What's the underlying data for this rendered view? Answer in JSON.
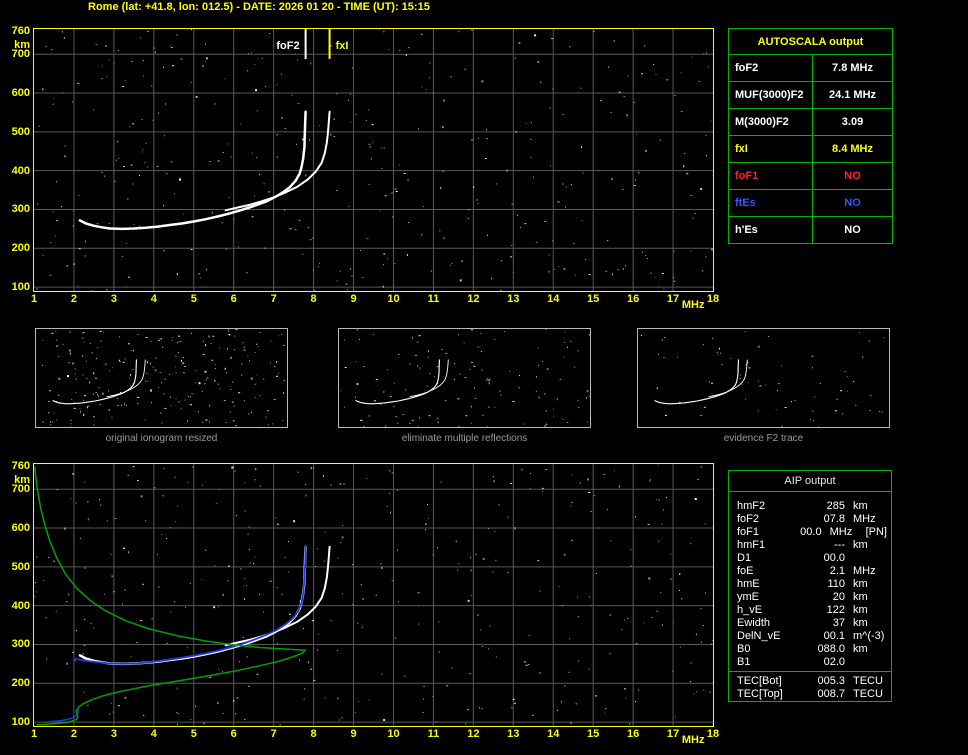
{
  "header": {
    "title": "Rome (lat: +41.8, lon: 012.5) - DATE: 2026 01 20 - TIME (UT): 15:15"
  },
  "colors": {
    "background": "#000000",
    "axis_label": "#ffff00",
    "chart_border": "#ffff00",
    "grid": "#585858",
    "table_border": "#00b400",
    "caption": "#9a9a9a",
    "trace_white": "#ffffff",
    "trace_blue": "#2233ee",
    "profile_green": "#00a000",
    "fxI_yellow": "#ffff00",
    "foF1_red": "#ff2222",
    "ftEs_blue": "#3355ff"
  },
  "autoscala_table": {
    "title": "AUTOSCALA output",
    "rows": [
      {
        "label": "foF2",
        "value": "7.8 MHz",
        "color": "#ffffff"
      },
      {
        "label": "MUF(3000)F2",
        "value": "24.1 MHz",
        "color": "#ffffff"
      },
      {
        "label": "M(3000)F2",
        "value": "3.09",
        "color": "#ffffff"
      },
      {
        "label": "fxI",
        "value": "8.4 MHz",
        "color": "#ffff00"
      },
      {
        "label": "foF1",
        "value": "NO",
        "color": "#ff2222"
      },
      {
        "label": "ftEs",
        "value": "NO",
        "color": "#3355ff"
      },
      {
        "label": "h'Es",
        "value": "NO",
        "color": "#ffffff"
      }
    ]
  },
  "aip_table": {
    "title": "AIP output",
    "rows": [
      {
        "label": "hmF2",
        "value": "285",
        "unit": "km"
      },
      {
        "label": "foF2",
        "value": "07.8",
        "unit": "MHz"
      },
      {
        "label": "foF1",
        "value": "00.0",
        "unit": "MHz",
        "extra": "[PN]"
      },
      {
        "label": "hmF1",
        "value": "---",
        "unit": "km"
      },
      {
        "label": "D1",
        "value": "00.0",
        "unit": ""
      },
      {
        "label": "foE",
        "value": "2.1",
        "unit": "MHz"
      },
      {
        "label": "hmE",
        "value": "110",
        "unit": "km"
      },
      {
        "label": "ymE",
        "value": "20",
        "unit": "km"
      },
      {
        "label": "h_vE",
        "value": "122",
        "unit": "km"
      },
      {
        "label": "Ewidth",
        "value": "37",
        "unit": "km"
      },
      {
        "label": "DelN_vE",
        "value": "00.1",
        "unit": "m^(-3)"
      },
      {
        "label": "B0",
        "value": "088.0",
        "unit": "km"
      },
      {
        "label": "B1",
        "value": "02.0",
        "unit": ""
      }
    ],
    "tec_rows": [
      {
        "label": "TEC[Bot]",
        "value": "005.3",
        "unit": "TECU"
      },
      {
        "label": "TEC[Top]",
        "value": "008.7",
        "unit": "TECU"
      }
    ]
  },
  "thumbnails": [
    {
      "caption": "original ionogram resized"
    },
    {
      "caption": "eliminate multiple reflections"
    },
    {
      "caption": "evidence F2 trace"
    }
  ],
  "chart_data": [
    {
      "id": "top_ionogram",
      "type": "scatter",
      "title": "",
      "xlabel": "MHz",
      "ylabel": "km",
      "xlim": [
        1,
        18
      ],
      "ylim": [
        90,
        765
      ],
      "grid": true,
      "xticks": [
        "1",
        "2",
        "3",
        "4",
        "5",
        "6",
        "7",
        "8",
        "9",
        "10",
        "11",
        "12",
        "13",
        "14",
        "15",
        "16",
        "17",
        "18"
      ],
      "yticks": [
        760,
        700,
        600,
        500,
        400,
        300,
        200,
        100
      ],
      "series": [
        {
          "name": "o-trace",
          "color": "#ffffff",
          "width": 2.5,
          "points": [
            [
              2.15,
              272
            ],
            [
              2.3,
              264
            ],
            [
              2.5,
              258
            ],
            [
              2.7,
              254
            ],
            [
              2.9,
              251
            ],
            [
              3.2,
              250
            ],
            [
              3.5,
              251
            ],
            [
              3.8,
              253
            ],
            [
              4.1,
              256
            ],
            [
              4.4,
              260
            ],
            [
              4.7,
              264
            ],
            [
              5.0,
              269
            ],
            [
              5.3,
              275
            ],
            [
              5.6,
              282
            ],
            [
              5.9,
              290
            ],
            [
              6.2,
              299
            ],
            [
              6.5,
              309
            ],
            [
              6.8,
              320
            ],
            [
              7.0,
              330
            ],
            [
              7.2,
              342
            ],
            [
              7.4,
              357
            ],
            [
              7.55,
              374
            ],
            [
              7.65,
              392
            ],
            [
              7.7,
              410
            ],
            [
              7.74,
              432
            ],
            [
              7.77,
              460
            ],
            [
              7.78,
              495
            ],
            [
              7.79,
              525
            ],
            [
              7.8,
              552
            ]
          ]
        },
        {
          "name": "x-trace",
          "color": "#ffffff",
          "width": 2,
          "points": [
            [
              5.8,
              298
            ],
            [
              6.1,
              305
            ],
            [
              6.4,
              312
            ],
            [
              6.7,
              321
            ],
            [
              7.0,
              331
            ],
            [
              7.3,
              344
            ],
            [
              7.6,
              359
            ],
            [
              7.85,
              377
            ],
            [
              8.05,
              397
            ],
            [
              8.2,
              420
            ],
            [
              8.28,
              445
            ],
            [
              8.33,
              472
            ],
            [
              8.36,
              500
            ],
            [
              8.38,
              525
            ],
            [
              8.4,
              552
            ]
          ]
        }
      ],
      "markers": [
        {
          "label": "foF2",
          "freq": 7.8,
          "color": "#ffffff",
          "side": "left"
        },
        {
          "label": "fxI",
          "freq": 8.4,
          "color": "#ffff00",
          "side": "right"
        }
      ]
    },
    {
      "id": "bottom_ionogram_with_profile",
      "type": "scatter",
      "title": "",
      "xlabel": "MHz",
      "ylabel": "km",
      "xlim": [
        1,
        18
      ],
      "ylim": [
        90,
        765
      ],
      "grid": true,
      "xticks": [
        "1",
        "2",
        "3",
        "4",
        "5",
        "6",
        "7",
        "8",
        "9",
        "10",
        "11",
        "12",
        "13",
        "14",
        "15",
        "16",
        "17",
        "18"
      ],
      "yticks": [
        760,
        700,
        600,
        500,
        400,
        300,
        200,
        100
      ],
      "series": [
        {
          "name": "o-trace",
          "color": "#ffffff",
          "width": 2.5,
          "points": [
            [
              2.15,
              272
            ],
            [
              2.3,
              264
            ],
            [
              2.5,
              258
            ],
            [
              2.7,
              254
            ],
            [
              2.9,
              251
            ],
            [
              3.2,
              250
            ],
            [
              3.5,
              251
            ],
            [
              3.8,
              253
            ],
            [
              4.1,
              256
            ],
            [
              4.4,
              260
            ],
            [
              4.7,
              264
            ],
            [
              5.0,
              269
            ],
            [
              5.3,
              275
            ],
            [
              5.6,
              282
            ],
            [
              5.9,
              290
            ],
            [
              6.2,
              299
            ],
            [
              6.5,
              309
            ],
            [
              6.8,
              320
            ],
            [
              7.0,
              330
            ],
            [
              7.2,
              342
            ],
            [
              7.4,
              357
            ],
            [
              7.55,
              374
            ],
            [
              7.65,
              392
            ],
            [
              7.7,
              410
            ],
            [
              7.74,
              432
            ],
            [
              7.77,
              460
            ],
            [
              7.78,
              495
            ],
            [
              7.79,
              525
            ],
            [
              7.8,
              552
            ]
          ]
        },
        {
          "name": "x-trace",
          "color": "#ffffff",
          "width": 2,
          "points": [
            [
              5.8,
              298
            ],
            [
              6.1,
              305
            ],
            [
              6.4,
              312
            ],
            [
              6.7,
              321
            ],
            [
              7.0,
              331
            ],
            [
              7.3,
              344
            ],
            [
              7.6,
              359
            ],
            [
              7.85,
              377
            ],
            [
              8.05,
              397
            ],
            [
              8.2,
              420
            ],
            [
              8.28,
              445
            ],
            [
              8.33,
              472
            ],
            [
              8.36,
              500
            ],
            [
              8.38,
              525
            ],
            [
              8.4,
              552
            ]
          ]
        },
        {
          "name": "fitted-trace",
          "color": "#2233ee",
          "width": 1.8,
          "points": [
            [
              2.0,
              264
            ],
            [
              2.3,
              258
            ],
            [
              2.6,
              254
            ],
            [
              2.9,
              251
            ],
            [
              3.2,
              250
            ],
            [
              3.5,
              251
            ],
            [
              3.8,
              253
            ],
            [
              4.1,
              257
            ],
            [
              4.4,
              261
            ],
            [
              4.7,
              266
            ],
            [
              5.0,
              271
            ],
            [
              5.3,
              277
            ],
            [
              5.6,
              284
            ],
            [
              5.9,
              292
            ],
            [
              6.2,
              301
            ],
            [
              6.5,
              312
            ],
            [
              6.8,
              324
            ],
            [
              7.1,
              339
            ],
            [
              7.3,
              352
            ],
            [
              7.5,
              369
            ],
            [
              7.62,
              387
            ],
            [
              7.7,
              408
            ],
            [
              7.74,
              432
            ],
            [
              7.77,
              465
            ],
            [
              7.79,
              510
            ],
            [
              7.8,
              555
            ]
          ]
        },
        {
          "name": "e-region-trace",
          "color": "#2233ee",
          "width": 1.5,
          "points": [
            [
              1.35,
              101
            ],
            [
              1.6,
              103
            ],
            [
              1.8,
              106
            ],
            [
              1.95,
              110
            ],
            [
              2.05,
              116
            ],
            [
              2.1,
              124
            ],
            [
              2.12,
              132
            ]
          ]
        },
        {
          "name": "electron-density-profile",
          "color": "#00a000",
          "width": 1.5,
          "points": [
            [
              1.02,
              758
            ],
            [
              1.05,
              725
            ],
            [
              1.1,
              690
            ],
            [
              1.17,
              650
            ],
            [
              1.27,
              608
            ],
            [
              1.4,
              565
            ],
            [
              1.57,
              523
            ],
            [
              1.78,
              483
            ],
            [
              2.05,
              447
            ],
            [
              2.4,
              414
            ],
            [
              2.8,
              386
            ],
            [
              3.3,
              361
            ],
            [
              3.9,
              340
            ],
            [
              4.6,
              322
            ],
            [
              5.3,
              309
            ],
            [
              6.0,
              299
            ],
            [
              6.7,
              292
            ],
            [
              7.3,
              288
            ],
            [
              7.65,
              286
            ],
            [
              7.8,
              285
            ],
            [
              7.7,
              277
            ],
            [
              7.45,
              267
            ],
            [
              7.1,
              256
            ],
            [
              6.6,
              244
            ],
            [
              6.0,
              231
            ],
            [
              5.3,
              218
            ],
            [
              4.6,
              206
            ],
            [
              3.9,
              194
            ],
            [
              3.3,
              182
            ],
            [
              2.8,
              170
            ],
            [
              2.45,
              158
            ],
            [
              2.22,
              147
            ],
            [
              2.1,
              137
            ],
            [
              2.06,
              128
            ],
            [
              2.08,
              120
            ],
            [
              2.1,
              112
            ],
            [
              2.05,
              106
            ],
            [
              1.9,
              101
            ],
            [
              1.65,
              97
            ],
            [
              1.35,
              95
            ],
            [
              1.08,
              93
            ]
          ]
        }
      ],
      "markers": []
    }
  ]
}
